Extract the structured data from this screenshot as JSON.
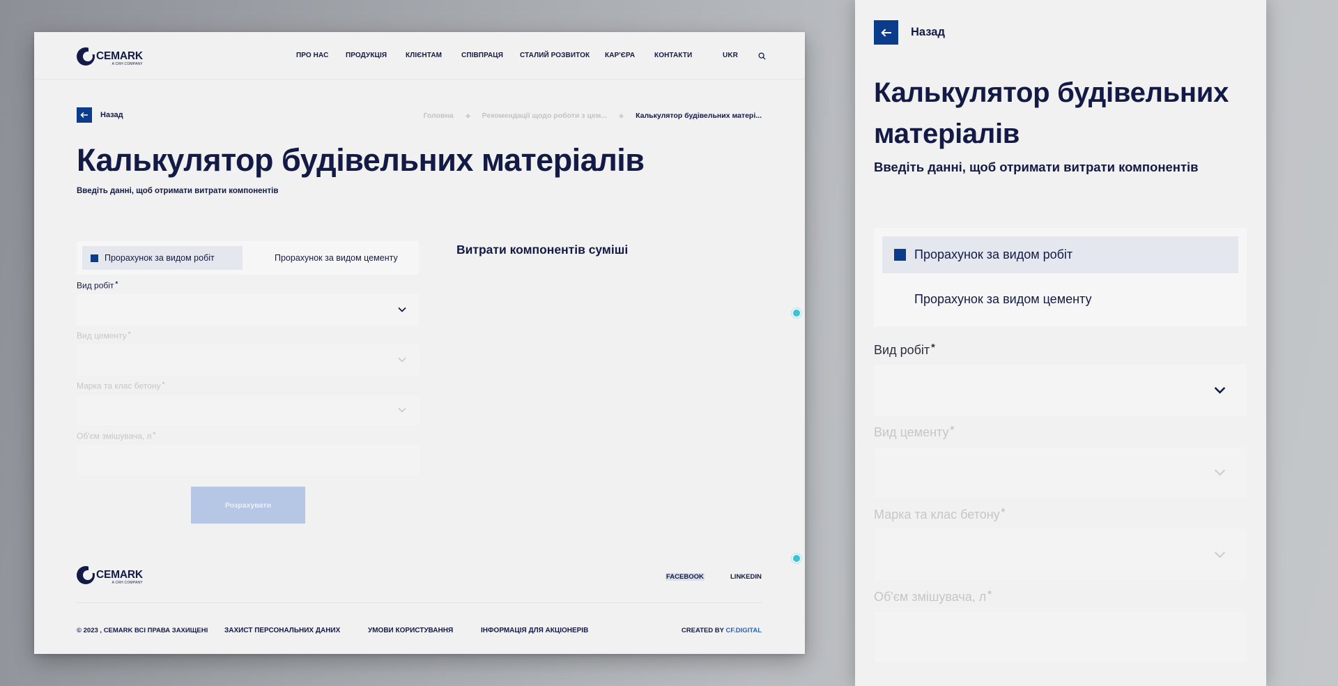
{
  "brand": {
    "name": "CEMARK",
    "tagline": "A CRH COMPANY"
  },
  "nav": {
    "items": [
      "ПРО НАС",
      "ПРОДУКЦІЯ",
      "КЛІЄНТАМ",
      "СПІВПРАЦЯ",
      "СТАЛИЙ РОЗВИТОК",
      "КАР'ЄРА",
      "КОНТАКТИ"
    ],
    "language": "UKR",
    "search_icon": "search-icon"
  },
  "back": {
    "label": "Назад",
    "icon": "arrow-left-icon"
  },
  "breadcrumbs": [
    "Головна",
    "Рекомендації щодо роботи з цем...",
    "Калькулятор будівельних матері..."
  ],
  "page": {
    "title": "Калькулятор будівельних матеріалів",
    "subtitle": "Введіть данні, щоб отримати витрати компонентів"
  },
  "tabs": [
    {
      "label": "Прорахунок за видом робіт",
      "active": true
    },
    {
      "label": "Прорахунок за видом цементу",
      "active": false
    }
  ],
  "fields": [
    {
      "label": "Вид робіт",
      "required": "*",
      "value": "",
      "enabled": true
    },
    {
      "label": "Вид цементу",
      "required": "*",
      "value": "",
      "enabled": false
    },
    {
      "label": "Марка та клас бетону",
      "required": "*",
      "value": "",
      "enabled": false
    },
    {
      "label": "Об'єм змішувача, л",
      "required": "*",
      "value": "",
      "enabled": false
    }
  ],
  "calculate_button": "Розрахувати",
  "results": {
    "title": "Витрати компонентів суміші"
  },
  "footer": {
    "social": [
      "FACEBOOK",
      "LINKEDIN"
    ],
    "copyright": "© 2023 , CEMARK ВСІ ПРАВА ЗАХИЩЕНІ",
    "links": [
      "ЗАХИСТ ПЕРСОНАЛЬНИХ ДАНИХ",
      "УМОВИ КОРИСТУВАННЯ",
      "ІНФОРМАЦІЯ ДЛЯ АКЦІОНЕРІВ"
    ],
    "created_by": "CREATED BY",
    "agency": "CF.DIGITAL"
  },
  "colors": {
    "navy": "#131a45",
    "accent_blue": "#0b3c8c",
    "disabled_button": "#b6c7e5",
    "page_bg": "#f1f1f1"
  }
}
